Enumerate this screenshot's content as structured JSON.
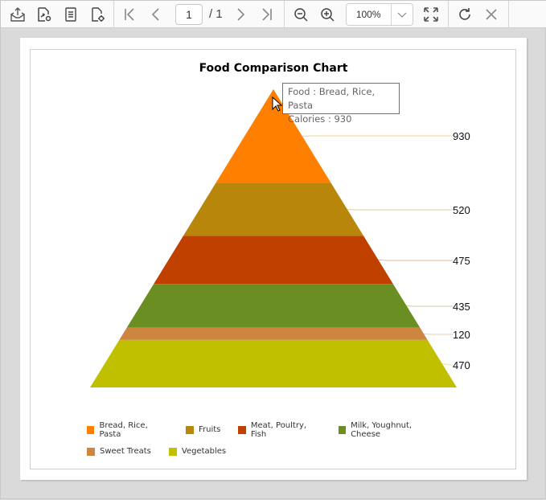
{
  "toolbar": {
    "icons": [
      "export-icon",
      "export-settings-icon",
      "document-icon",
      "page-setup-icon",
      "first-page-icon",
      "previous-page-icon",
      "next-page-icon",
      "last-page-icon",
      "zoom-out-icon",
      "zoom-in-icon",
      "fit-page-icon",
      "refresh-icon",
      "close-icon"
    ],
    "current_page": "1",
    "total_pages": "/ 1",
    "zoom_level": "100%"
  },
  "tooltip": {
    "line1": "Food : Bread, Rice, Pasta",
    "line2": "Calories : 930"
  },
  "chart_data": {
    "type": "pyramid",
    "title": "Food Comparison Chart",
    "categories": [
      "Bread, Rice, Pasta",
      "Fruits",
      "Meat, Poultry, Fish",
      "Milk, Youghnut, Cheese",
      "Sweet Treats",
      "Vegetables"
    ],
    "values": [
      930,
      520,
      475,
      435,
      120,
      470
    ],
    "data_labels": [
      "930",
      "520",
      "475",
      "435",
      "120",
      "470"
    ],
    "colors": [
      "#ff8000",
      "#b8860b",
      "#c04000",
      "#6b8e23",
      "#cd853f",
      "#c0c000"
    ],
    "legend_position": "bottom",
    "xlabel": "",
    "ylabel": ""
  }
}
